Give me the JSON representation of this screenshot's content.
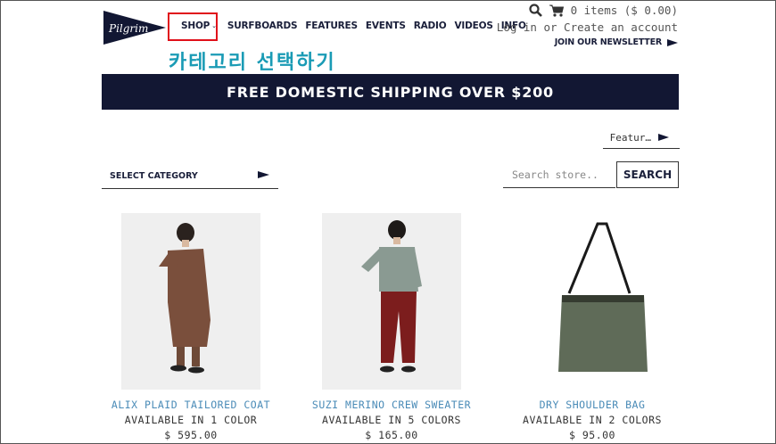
{
  "brand": {
    "logo_text": "Pilgrim"
  },
  "nav": {
    "items": [
      "SHOP",
      "SURFBOARDS",
      "FEATURES",
      "EVENTS",
      "RADIO",
      "VIDEOS",
      "INFO"
    ]
  },
  "annotation": "카테고리 선택하기",
  "header": {
    "cart_text": "0 items ($ 0.00)",
    "account_text": "Log in or Create an account",
    "newsletter_text": "JOIN OUR NEWSLETTER"
  },
  "banner": {
    "text": "FREE DOMESTIC SHIPPING OVER $200"
  },
  "sort": {
    "label": "Featur…"
  },
  "category": {
    "label": "SELECT CATEGORY"
  },
  "search": {
    "placeholder": "Search store..",
    "button_label": "SEARCH"
  },
  "products": [
    {
      "name": "ALIX PLAID TAILORED COAT",
      "availability": "AVAILABLE IN 1 COLOR",
      "price": "$ 595.00"
    },
    {
      "name": "SUZI MERINO CREW SWEATER",
      "availability": "AVAILABLE IN 5 COLORS",
      "price": "$ 165.00"
    },
    {
      "name": "DRY SHOULDER BAG",
      "availability": "AVAILABLE IN 2 COLORS",
      "price": "$ 95.00"
    }
  ],
  "colors": {
    "navy": "#121733",
    "highlight": "#e0101a",
    "annotation": "#1a9bb5",
    "link": "#4a8bb7"
  }
}
